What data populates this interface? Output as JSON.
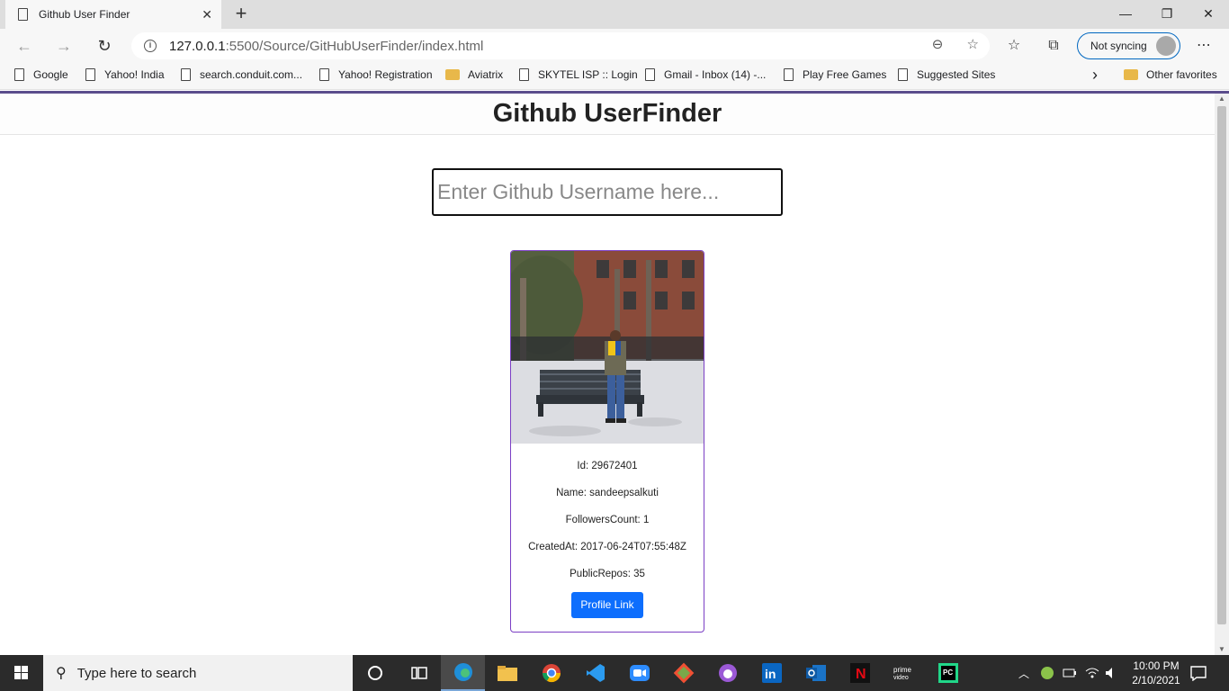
{
  "browser": {
    "tab_title": "Github User Finder",
    "tab_close": "✕",
    "new_tab": "+",
    "window_controls": {
      "minimize": "—",
      "maximize": "❐",
      "close": "✕"
    },
    "address_host": "127.0.0.1",
    "address_rest": ":5500/Source/GitHubUserFinder/index.html",
    "sync_label": "Not syncing",
    "more_label": "⋯",
    "bookmarks": [
      {
        "label": "Google",
        "icon": "page-icon"
      },
      {
        "label": "Yahoo! India",
        "icon": "page-icon"
      },
      {
        "label": "search.conduit.com...",
        "icon": "page-icon"
      },
      {
        "label": "Yahoo! Registration",
        "icon": "page-icon"
      },
      {
        "label": "Aviatrix",
        "icon": "folder-icon"
      },
      {
        "label": "SKYTEL ISP :: Login",
        "icon": "page-icon"
      },
      {
        "label": "Gmail - Inbox (14) -...",
        "icon": "page-icon"
      },
      {
        "label": "Play Free Games",
        "icon": "page-icon"
      },
      {
        "label": "Suggested Sites",
        "icon": "page-icon"
      }
    ],
    "overflow_chevron": "›",
    "other_favorites": "Other favorites"
  },
  "page": {
    "title": "Github UserFinder",
    "search_placeholder": "Enter Github Username here...",
    "search_value": ""
  },
  "user_card": {
    "id_line": "Id: 29672401",
    "name_line": "Name: sandeepsalkuti",
    "followers_line": "FollowersCount: 1",
    "created_line": "CreatedAt: 2017-06-24T07:55:48Z",
    "repos_line": "PublicRepos: 35",
    "profile_button": "Profile Link"
  },
  "taskbar": {
    "search_placeholder": "Type here to search",
    "apps": [
      "task-view",
      "widgets",
      "edge",
      "file-explorer",
      "chrome",
      "vscode",
      "zoom",
      "git",
      "github-desktop",
      "linkedin",
      "outlook",
      "netflix",
      "prime-video",
      "pycharm"
    ],
    "time": "10:00 PM",
    "date": "2/10/2021"
  },
  "colors": {
    "card_border": "#7b3fc4",
    "button_bg": "#0d6efd",
    "accent_line": "#5b4d8c",
    "sync_border": "#0067c0"
  }
}
